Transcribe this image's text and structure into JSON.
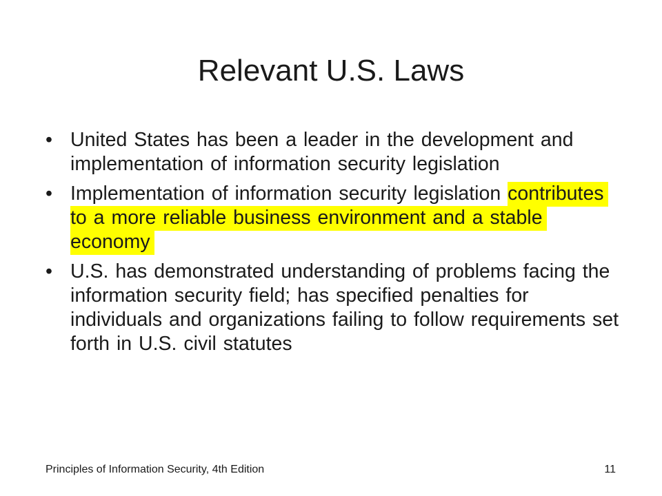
{
  "slide": {
    "title": "Relevant U.S. Laws",
    "bullet_glyph": "•",
    "bullets": [
      {
        "text": "United States has been a leader in the development and implementation of information security legislation"
      },
      {
        "text": "Implementation of information security legislation ",
        "highlighted_text": "contributes to a more reliable business environment and a stable economy"
      },
      {
        "text": "U.S. has demonstrated understanding of problems facing the information security field; has specified penalties for individuals and organizations failing to follow requirements set forth in U.S. civil statutes"
      }
    ],
    "highlight_color": "#ffff00"
  },
  "footer": {
    "left": "Principles of Information Security, 4th Edition",
    "page_number": "11"
  }
}
